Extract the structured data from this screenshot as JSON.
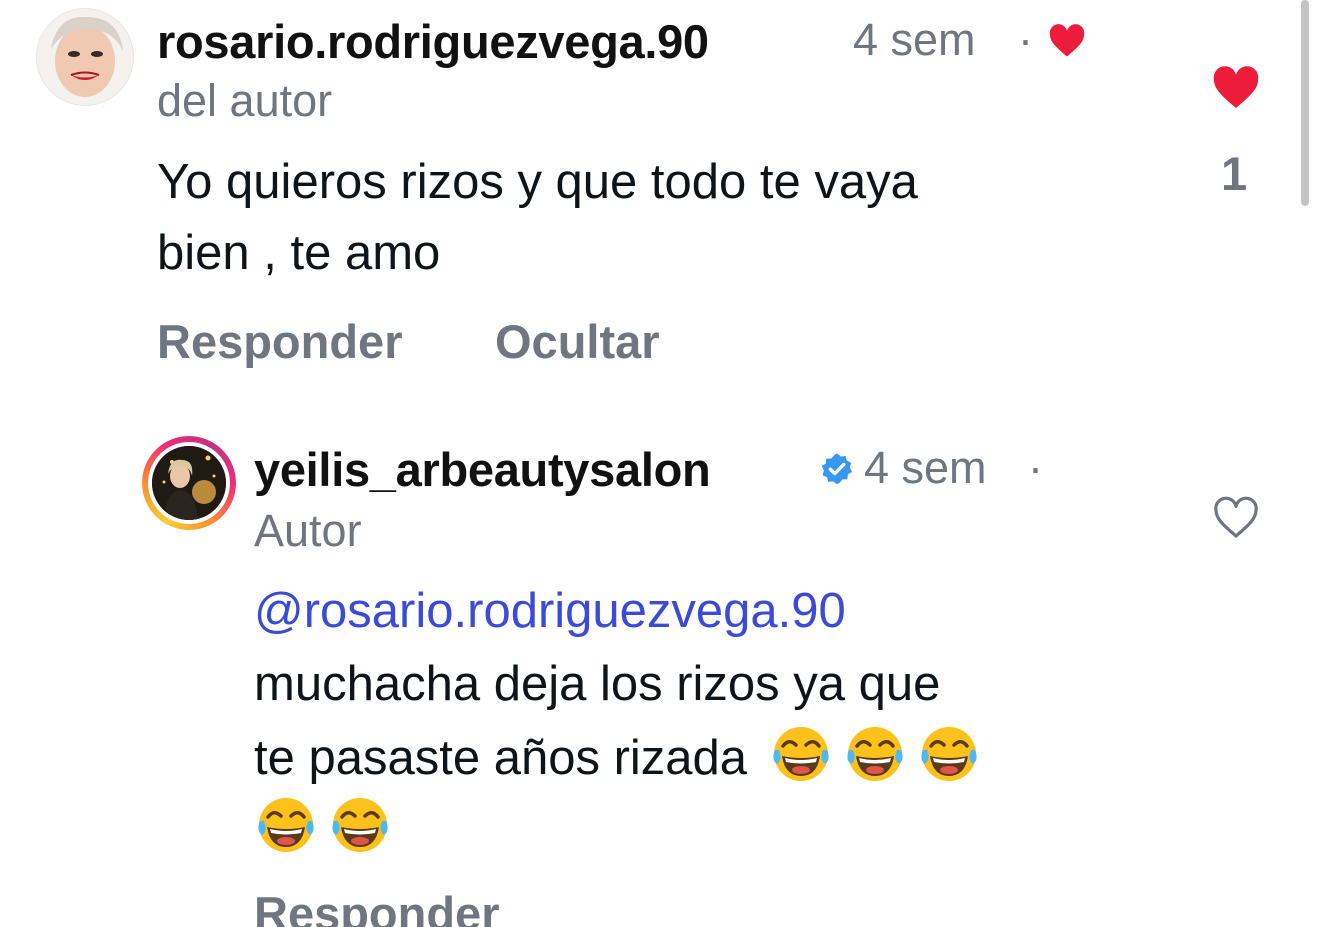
{
  "comment": {
    "username": "rosario.rodriguezvega.90",
    "time": "4 sem",
    "separator": "·",
    "author_tag": "del autor",
    "text_line1": "Yo quieros  rizos y que todo te vaya",
    "text_line2": "bien , te amo",
    "like_count": "1",
    "actions": {
      "reply": "Responder",
      "hide": "Ocultar"
    },
    "liked_by_author_icon": "heart-icon",
    "like_icon": "heart-filled-icon",
    "colors": {
      "heart": "#ed1c3a"
    }
  },
  "reply": {
    "username": "yeilis_arbeautysalon",
    "verified_icon": "verified-badge-icon",
    "time": "4 sem",
    "separator": "·",
    "author_tag": "Autor",
    "mention": "@rosario.rodriguezvega.90",
    "text_line1": "muchacha deja los rizos ya que",
    "text_line2": "te pasaste años rizada",
    "emoji_icon": "laughing-tears-emoji",
    "emoji_count": 5,
    "like_icon": "heart-outline-icon",
    "actions": {
      "reply": "Responder"
    },
    "colors": {
      "mention": "#3b4bd8",
      "verified": "#3897f0"
    }
  }
}
